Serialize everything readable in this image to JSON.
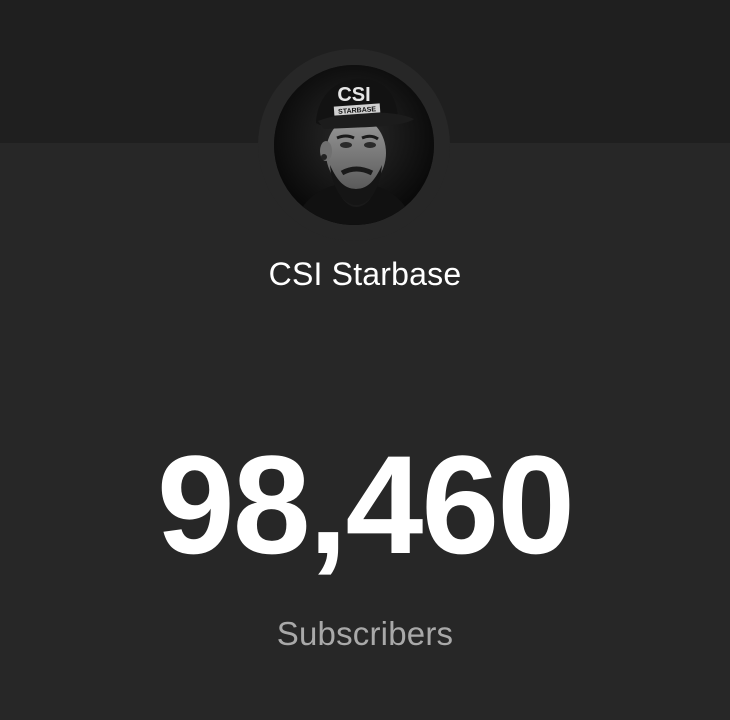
{
  "channel": {
    "name": "CSI Starbase",
    "avatar_alt": "channel-avatar",
    "hat_text_main": "CSI",
    "hat_text_sub": "STARBASE"
  },
  "stats": {
    "subscriber_count": "98,460",
    "subscriber_label": "Subscribers"
  },
  "colors": {
    "background": "#272727",
    "top_band": "#1f1f1f",
    "text_primary": "#ffffff",
    "text_secondary": "#a9a9a9"
  }
}
